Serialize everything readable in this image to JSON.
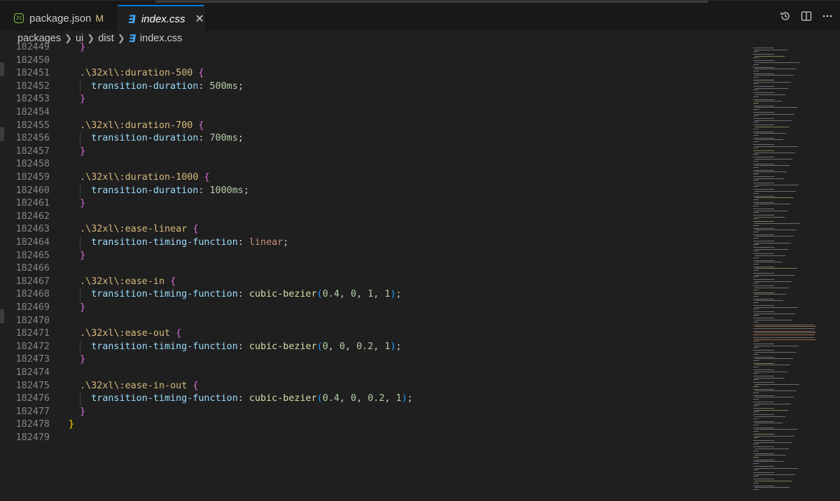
{
  "tabs": [
    {
      "label": "package.json",
      "modified": "M",
      "icon": "json-file-icon"
    },
    {
      "label": "index.css",
      "close": "✕",
      "icon": "css-file-icon"
    }
  ],
  "actions": {
    "timeline": "timeline-icon",
    "split": "split-editor-icon",
    "more": "more-actions-icon"
  },
  "breadcrumb": [
    "packages",
    "ui",
    "dist",
    "index.css"
  ],
  "lines": [
    {
      "n": "182449",
      "tokens": [
        [
          "brace",
          "}"
        ]
      ],
      "indent": 1
    },
    {
      "n": "182450",
      "tokens": [],
      "indent": 0
    },
    {
      "n": "182451",
      "tokens": [
        [
          "sel",
          ".\\32xl\\:duration-500 "
        ],
        [
          "brace",
          "{"
        ]
      ],
      "indent": 1
    },
    {
      "n": "182452",
      "tokens": [
        [
          "prop",
          "transition-duration"
        ],
        [
          "pun",
          ": "
        ],
        [
          "num",
          "500ms"
        ],
        [
          "pun",
          ";"
        ]
      ],
      "indent": 2
    },
    {
      "n": "182453",
      "tokens": [
        [
          "brace",
          "}"
        ]
      ],
      "indent": 1
    },
    {
      "n": "182454",
      "tokens": [],
      "indent": 0
    },
    {
      "n": "182455",
      "tokens": [
        [
          "sel",
          ".\\32xl\\:duration-700 "
        ],
        [
          "brace",
          "{"
        ]
      ],
      "indent": 1
    },
    {
      "n": "182456",
      "tokens": [
        [
          "prop",
          "transition-duration"
        ],
        [
          "pun",
          ": "
        ],
        [
          "num",
          "700ms"
        ],
        [
          "pun",
          ";"
        ]
      ],
      "indent": 2
    },
    {
      "n": "182457",
      "tokens": [
        [
          "brace",
          "}"
        ]
      ],
      "indent": 1
    },
    {
      "n": "182458",
      "tokens": [],
      "indent": 0
    },
    {
      "n": "182459",
      "tokens": [
        [
          "sel",
          ".\\32xl\\:duration-1000 "
        ],
        [
          "brace",
          "{"
        ]
      ],
      "indent": 1
    },
    {
      "n": "182460",
      "tokens": [
        [
          "prop",
          "transition-duration"
        ],
        [
          "pun",
          ": "
        ],
        [
          "num",
          "1000ms"
        ],
        [
          "pun",
          ";"
        ]
      ],
      "indent": 2
    },
    {
      "n": "182461",
      "tokens": [
        [
          "brace",
          "}"
        ]
      ],
      "indent": 1
    },
    {
      "n": "182462",
      "tokens": [],
      "indent": 0
    },
    {
      "n": "182463",
      "tokens": [
        [
          "sel",
          ".\\32xl\\:ease-linear "
        ],
        [
          "brace",
          "{"
        ]
      ],
      "indent": 1
    },
    {
      "n": "182464",
      "tokens": [
        [
          "prop",
          "transition-timing-function"
        ],
        [
          "pun",
          ": "
        ],
        [
          "kw",
          "linear"
        ],
        [
          "pun",
          ";"
        ]
      ],
      "indent": 2
    },
    {
      "n": "182465",
      "tokens": [
        [
          "brace",
          "}"
        ]
      ],
      "indent": 1
    },
    {
      "n": "182466",
      "tokens": [],
      "indent": 0
    },
    {
      "n": "182467",
      "tokens": [
        [
          "sel",
          ".\\32xl\\:ease-in "
        ],
        [
          "brace",
          "{"
        ]
      ],
      "indent": 1
    },
    {
      "n": "182468",
      "tokens": [
        [
          "prop",
          "transition-timing-function"
        ],
        [
          "pun",
          ": "
        ],
        [
          "fn",
          "cubic-bezier"
        ],
        [
          "paren",
          "("
        ],
        [
          "num",
          "0.4"
        ],
        [
          "pun",
          ", "
        ],
        [
          "num",
          "0"
        ],
        [
          "pun",
          ", "
        ],
        [
          "num",
          "1"
        ],
        [
          "pun",
          ", "
        ],
        [
          "num",
          "1"
        ],
        [
          "paren",
          ")"
        ],
        [
          "pun",
          ";"
        ]
      ],
      "indent": 2
    },
    {
      "n": "182469",
      "tokens": [
        [
          "brace",
          "}"
        ]
      ],
      "indent": 1
    },
    {
      "n": "182470",
      "tokens": [],
      "indent": 0
    },
    {
      "n": "182471",
      "tokens": [
        [
          "sel",
          ".\\32xl\\:ease-out "
        ],
        [
          "brace",
          "{"
        ]
      ],
      "indent": 1
    },
    {
      "n": "182472",
      "tokens": [
        [
          "prop",
          "transition-timing-function"
        ],
        [
          "pun",
          ": "
        ],
        [
          "fn",
          "cubic-bezier"
        ],
        [
          "paren",
          "("
        ],
        [
          "num",
          "0"
        ],
        [
          "pun",
          ", "
        ],
        [
          "num",
          "0"
        ],
        [
          "pun",
          ", "
        ],
        [
          "num",
          "0.2"
        ],
        [
          "pun",
          ", "
        ],
        [
          "num",
          "1"
        ],
        [
          "paren",
          ")"
        ],
        [
          "pun",
          ";"
        ]
      ],
      "indent": 2
    },
    {
      "n": "182473",
      "tokens": [
        [
          "brace",
          "}"
        ]
      ],
      "indent": 1
    },
    {
      "n": "182474",
      "tokens": [],
      "indent": 0
    },
    {
      "n": "182475",
      "tokens": [
        [
          "sel",
          ".\\32xl\\:ease-in-out "
        ],
        [
          "brace",
          "{"
        ]
      ],
      "indent": 1
    },
    {
      "n": "182476",
      "tokens": [
        [
          "prop",
          "transition-timing-function"
        ],
        [
          "pun",
          ": "
        ],
        [
          "fn",
          "cubic-bezier"
        ],
        [
          "paren",
          "("
        ],
        [
          "num",
          "0.4"
        ],
        [
          "pun",
          ", "
        ],
        [
          "num",
          "0"
        ],
        [
          "pun",
          ", "
        ],
        [
          "num",
          "0.2"
        ],
        [
          "pun",
          ", "
        ],
        [
          "num",
          "1"
        ],
        [
          "paren",
          ")"
        ],
        [
          "pun",
          ";"
        ]
      ],
      "indent": 2
    },
    {
      "n": "182477",
      "tokens": [
        [
          "brace",
          "}"
        ]
      ],
      "indent": 1
    },
    {
      "n": "182478",
      "tokens": [
        [
          "brace-y",
          "}"
        ]
      ],
      "indent": 0
    },
    {
      "n": "182479",
      "tokens": [],
      "indent": 0
    }
  ],
  "colors": {
    "selector": "#d7ba7d",
    "property": "#9cdcfe",
    "number": "#b5cea8",
    "keyword": "#ce9178",
    "function": "#dcdcaa",
    "brace": "#da70d6",
    "outer_brace": "#ffd700",
    "paren": "#179fff",
    "active_tab_accent": "#0078d4",
    "modified": "#e2c08d"
  }
}
